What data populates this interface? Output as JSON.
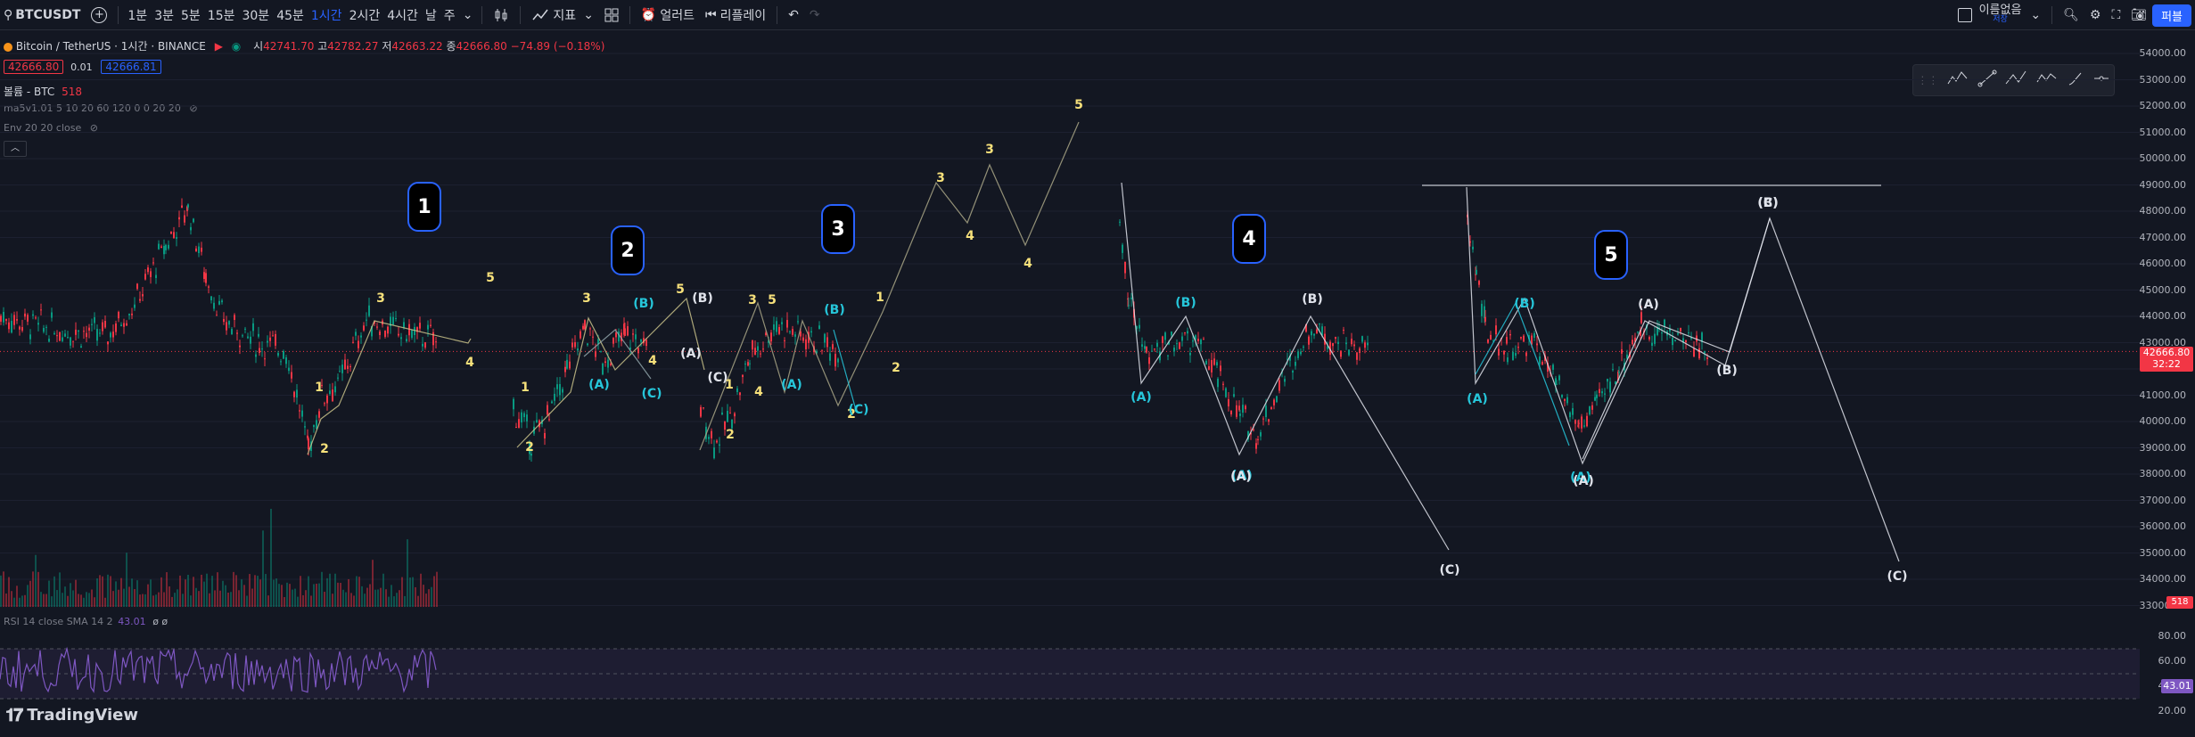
{
  "toolbar": {
    "symbol": "BTCUSDT",
    "intervals": [
      "1분",
      "3분",
      "5분",
      "15분",
      "30분",
      "45분",
      "1시간",
      "2시간",
      "4시간",
      "날",
      "주"
    ],
    "active_interval": "1시간",
    "indicators_label": "지표",
    "alert_label": "얼러트",
    "replay_label": "리플레이",
    "layout_name": "이름없음",
    "layout_sub": "저장",
    "publish_label": "퍼블"
  },
  "legend": {
    "title": "Bitcoin / TetherUS · 1시간 · BINANCE",
    "open_label": "시",
    "open": "42741.70",
    "high_label": "고",
    "high": "42782.27",
    "low_label": "저",
    "low": "42663.22",
    "close_label": "종",
    "close": "42666.80",
    "change": "−74.89 (−0.18%)",
    "bid": "42666.80",
    "spread": "0.01",
    "ask": "42666.81",
    "volume_label": "볼륨 - BTC",
    "volume_value": "518",
    "ma_label": "ma5v1.01 5 10 20 60 120 0 0 20 20",
    "env_label": "Env 20 20 close",
    "rsi_label": "RSI 14 close SMA 14 2",
    "rsi_value": "43.01",
    "rsi_extra": "ø ø"
  },
  "axis": {
    "prices": [
      "54000.00",
      "53000.00",
      "52000.00",
      "51000.00",
      "50000.00",
      "49000.00",
      "48000.00",
      "47000.00",
      "46000.00",
      "45000.00",
      "44000.00",
      "43000.00",
      "42000.00",
      "41000.00",
      "40000.00",
      "39000.00",
      "38000.00",
      "37000.00",
      "36000.00",
      "35000.00",
      "34000.00",
      "33000.00"
    ],
    "last_price": "42666.80",
    "countdown": "32:22",
    "volume_tag": "518",
    "rsi_ticks": [
      "80.00",
      "60.00",
      "40.00",
      "20.00"
    ],
    "rsi_tag": "43.01"
  },
  "waves": {
    "big": [
      "1",
      "2",
      "3",
      "4",
      "5"
    ],
    "labels": {
      "n1": "1",
      "n2": "2",
      "n3": "3",
      "n4": "4",
      "n5": "5",
      "A": "(A)",
      "B": "(B)",
      "C": "(C)"
    }
  },
  "logo": "TradingView",
  "colors": {
    "background": "#131722",
    "bear": "#f23645",
    "bull": "#089981",
    "wave_yellow": "#f7e17b",
    "wave_cyan": "#26c6da",
    "wave_white": "#e0e3eb",
    "accent": "#2962ff",
    "rsi": "#7e57c2"
  }
}
